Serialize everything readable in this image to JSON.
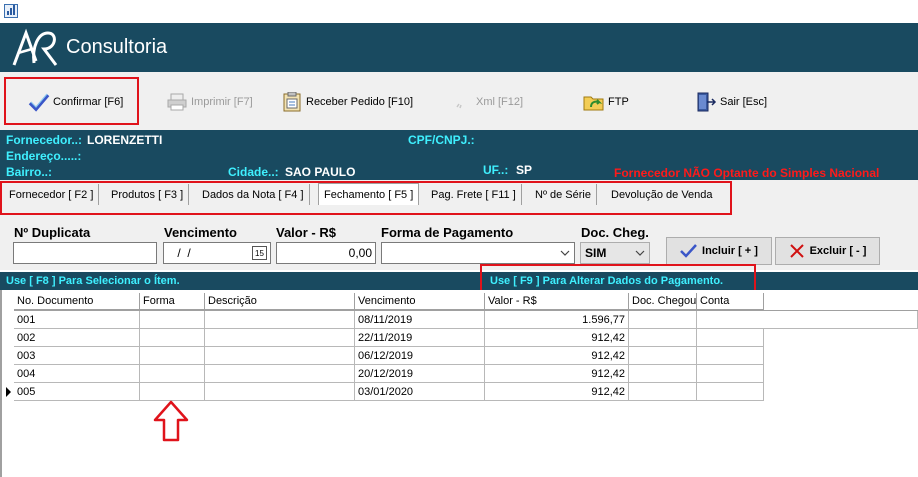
{
  "app": {
    "brand": "Consultoria",
    "logo_text": "AR"
  },
  "toolbar": {
    "confirm": "Confirmar [F6]",
    "print": "Imprimir  [F7]",
    "receive": "Receber Pedido [F10]",
    "xml": "Xml [F12]",
    "ftp": "FTP",
    "exit": "Sair [Esc]"
  },
  "info": {
    "supplier_label": "Fornecedor..:",
    "supplier_value": "LORENZETTI",
    "cpf_label": "CPF/CNPJ.:",
    "address_label": "Endereço.....:",
    "district_label": "Bairro..:",
    "city_label": "Cidade..:",
    "city_value": "SAO PAULO",
    "uf_label": "UF..:",
    "uf_value": "SP",
    "warning": "Fornecedor NÃO Optante do Simples Nacional"
  },
  "tabs": [
    {
      "label": "Fornecedor [ F2 ]"
    },
    {
      "label": "Produtos [ F3 ]"
    },
    {
      "label": "Dados da Nota [ F4 ]"
    },
    {
      "label": "Fechamento [ F5 ]"
    },
    {
      "label": "Pag. Frete [ F11 ]"
    },
    {
      "label": "Nº de Série"
    },
    {
      "label": "Devolução de Venda"
    }
  ],
  "form": {
    "duplicata_label": "Nº Duplicata",
    "duplicata_value": "",
    "vencimento_label": "Vencimento",
    "vencimento_value": " /  /",
    "calendar_label": "15",
    "valor_label": "Valor - R$",
    "valor_value": "0,00",
    "forma_label": "Forma de Pagamento",
    "forma_value": "",
    "doc_label": "Doc. Cheg.",
    "doc_value": "SIM",
    "add_button": "Incluir [ + ]",
    "delete_button": "Excluir [ - ]"
  },
  "hints": {
    "select_item": "Use [ F8 ] Para Selecionar o Ítem.",
    "edit_payment": "Use [ F9 ] Para Alterar Dados do Pagamento."
  },
  "grid": {
    "columns": [
      "No. Documento",
      "Forma",
      "Descrição",
      "Vencimento",
      "Valor - R$",
      "Doc. Chegou",
      "Conta"
    ],
    "rows": [
      [
        "001",
        "",
        "",
        "08/11/2019",
        "1.596,77",
        "",
        ""
      ],
      [
        "002",
        "",
        "",
        "22/11/2019",
        "912,42",
        "",
        ""
      ],
      [
        "003",
        "",
        "",
        "06/12/2019",
        "912,42",
        "",
        ""
      ],
      [
        "004",
        "",
        "",
        "20/12/2019",
        "912,42",
        "",
        ""
      ],
      [
        "005",
        "",
        "",
        "03/01/2020",
        "912,42",
        "",
        ""
      ]
    ]
  },
  "colors": {
    "header_bg": "#194a60",
    "label_cyan": "#3ff0ff",
    "annotation_red": "#e0131b"
  }
}
